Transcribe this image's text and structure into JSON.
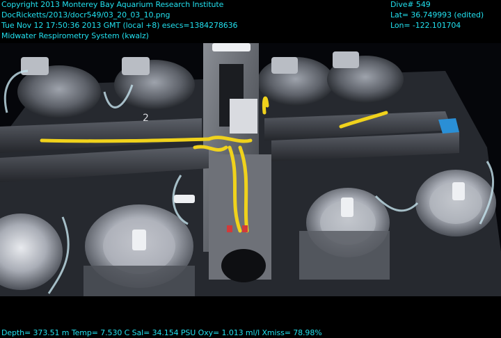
{
  "overlay": {
    "top_left": [
      "Copyright 2013 Monterey Bay Aquarium Research Institute",
      "DocRicketts/2013/docr549/03_20_03_10.png",
      "Tue Nov 12 17:50:36 2013 GMT (local +8)  esecs=1384278636",
      "Midwater Respirometry System (kwalz)"
    ],
    "top_right": [
      "Dive# 549",
      "Lat= 36.749993 (edited)",
      "Lon= -122.101704"
    ],
    "bottom": "Depth= 373.51 m  Temp= 7.530 C  Sal= 34.154 PSU  Oxy= 1.013 ml/l  Xmiss= 78.98%"
  },
  "colors": {
    "overlay_text": "#22e0ee",
    "background": "#000000",
    "frame_metal": "#3a3d44",
    "chamber_acrylic": "#c9ccd3",
    "cable_yellow": "#f0d21c",
    "accent_blue": "#2a8fd6"
  },
  "scene_labels": [
    "2"
  ]
}
